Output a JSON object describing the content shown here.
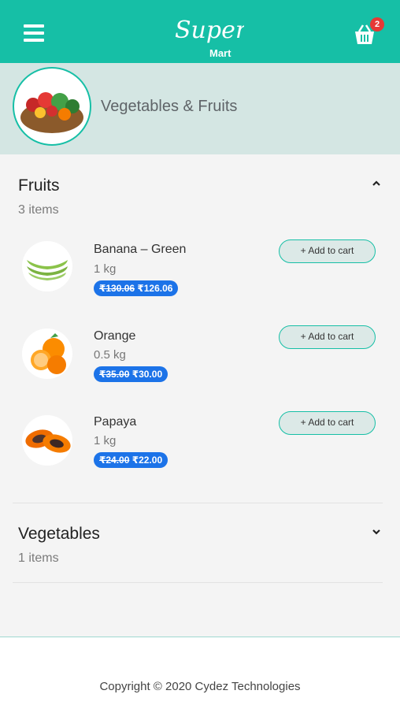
{
  "header": {
    "logo_main": "Super",
    "logo_sub": "Mart",
    "cart_count": "2",
    "brand_color": "#16bfa6"
  },
  "category": {
    "title": "Vegetables & Fruits"
  },
  "sections": [
    {
      "title": "Fruits",
      "count": "3 items",
      "expanded": true,
      "products": [
        {
          "name": "Banana – Green",
          "qty": "1 kg",
          "old_price": "₹130.06",
          "price": "₹126.06",
          "button": "+ Add to cart"
        },
        {
          "name": "Orange",
          "qty": "0.5 kg",
          "old_price": "₹35.00",
          "price": "₹30.00",
          "button": "+ Add to cart"
        },
        {
          "name": "Papaya",
          "qty": "1 kg",
          "old_price": "₹24.00",
          "price": "₹22.00",
          "button": "+ Add to cart"
        }
      ]
    },
    {
      "title": "Vegetables",
      "count": "1 items",
      "expanded": false
    }
  ],
  "footer": {
    "copyright": "Copyright © 2020 Cydez Technologies"
  }
}
